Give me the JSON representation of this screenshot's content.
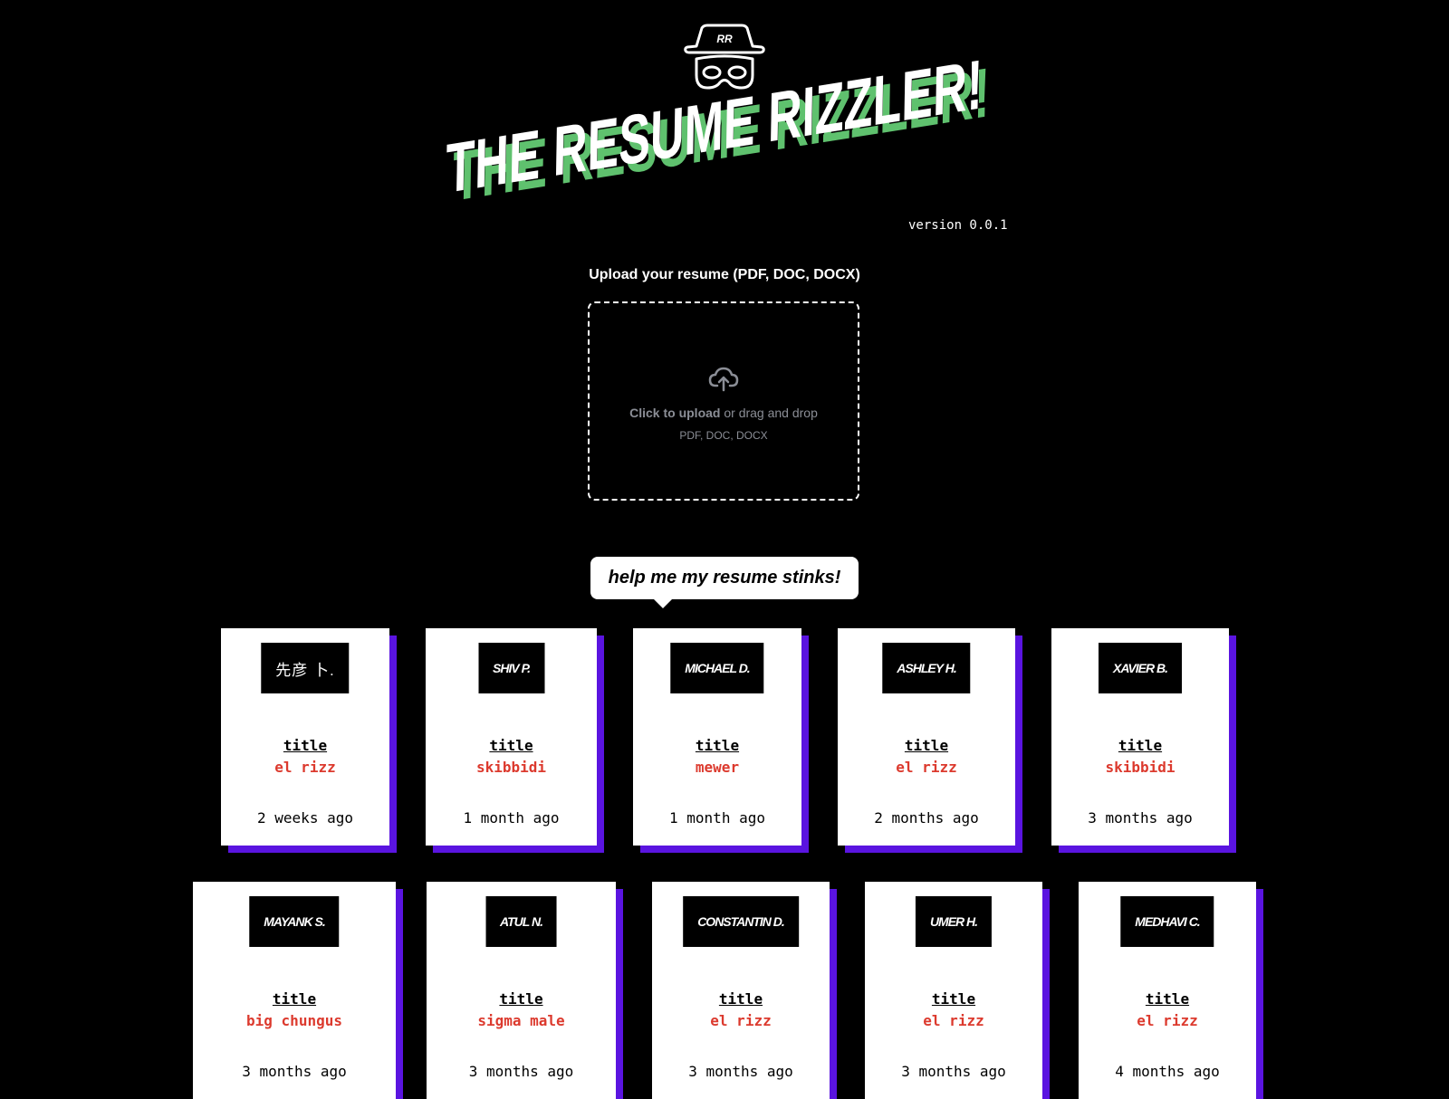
{
  "header": {
    "logo_initials": "RR",
    "title": "THE RESUME RIZZLER!",
    "version": "version 0.0.1"
  },
  "upload": {
    "label": "Upload your resume (PDF, DOC, DOCX)",
    "click_text": "Click to upload",
    "drag_text": " or drag and drop",
    "formats": "PDF, DOC, DOCX",
    "icon": "cloud-upload-icon"
  },
  "bubble": {
    "text": "help me my resume stinks!"
  },
  "colors": {
    "accent_shadow": "#5a14e0",
    "title_green": "#5fc16e",
    "tag_red": "#dc3a2e"
  },
  "cards": [
    {
      "name": "先彦 卜.",
      "title": "title",
      "tag": "el rizz",
      "time": "2 weeks ago"
    },
    {
      "name": "Shiv P.",
      "title": "title",
      "tag": "skibbidi",
      "time": "1 month ago"
    },
    {
      "name": "Michael D.",
      "title": "title",
      "tag": "mewer",
      "time": "1 month ago"
    },
    {
      "name": "Ashley H.",
      "title": "title",
      "tag": "el rizz",
      "time": "2 months ago"
    },
    {
      "name": "Xavier B.",
      "title": "title",
      "tag": "skibbidi",
      "time": "3 months ago"
    },
    {
      "name": "Mayank S.",
      "title": "title",
      "tag": "big chungus",
      "time": "3 months ago"
    },
    {
      "name": "Atul N.",
      "title": "title",
      "tag": "sigma male",
      "time": "3 months ago"
    },
    {
      "name": "Constantin D.",
      "title": "title",
      "tag": "el rizz",
      "time": "3 months ago"
    },
    {
      "name": "Umer H.",
      "title": "title",
      "tag": "el rizz",
      "time": "3 months ago"
    },
    {
      "name": "Medhavi C.",
      "title": "title",
      "tag": "el rizz",
      "time": "4 months ago"
    }
  ]
}
